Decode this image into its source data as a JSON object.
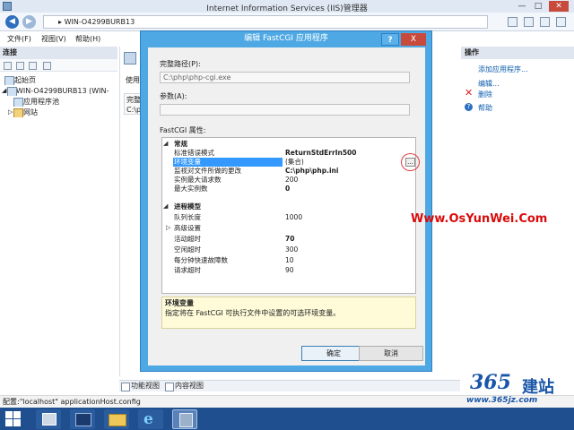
{
  "window": {
    "title": "Internet Information Services (IIS)管理器",
    "address": "WIN-O4299BURB13",
    "menu": [
      "文件(F)",
      "视图(V)",
      "帮助(H)"
    ]
  },
  "connections": {
    "heading": "连接",
    "tree": [
      "起始页",
      "WIN-O4299BURB13 (WIN-",
      "应用程序池",
      "网站"
    ]
  },
  "center": {
    "title_partial": "完",
    "label_partial": "使用",
    "col_partial": "完整",
    "cell_partial": "C:\\ph"
  },
  "actions": {
    "heading": "操作",
    "items": [
      "添加应用程序...",
      "编辑...",
      "删除",
      "帮助"
    ]
  },
  "bottom_tabs": [
    "功能视图",
    "内容视图"
  ],
  "status": "配置:\"localhost\" applicationHost.config",
  "dialog": {
    "title": "编辑 FastCGI 应用程序",
    "help_btn": "?",
    "close_btn": "X",
    "fullpath_label": "完整路径(P):",
    "fullpath_value": "C:\\php\\php-cgi.exe",
    "args_label": "参数(A):",
    "args_value": "",
    "props_label": "FastCGI 属性:",
    "sections": [
      {
        "name": "常规",
        "rows": [
          {
            "name": "标准错误模式",
            "value": "ReturnStdErrIn500",
            "bold": true
          },
          {
            "name": "环境变量",
            "value": "(集合)",
            "bold": false,
            "selected": true
          },
          {
            "name": "监视对文件所做的更改",
            "value": "C:\\php\\php.ini",
            "bold": true
          },
          {
            "name": "实例最大请求数",
            "value": "200",
            "bold": false
          },
          {
            "name": "最大实例数",
            "value": "0",
            "bold": true
          }
        ]
      },
      {
        "name": "进程模型",
        "rows": [
          {
            "name": "队列长度",
            "value": "1000",
            "bold": false
          },
          {
            "name": "高级设置",
            "value": "",
            "bold": false,
            "expandable": true
          },
          {
            "name": "活动超时",
            "value": "70",
            "bold": true
          },
          {
            "name": "空闲超时",
            "value": "300",
            "bold": false
          },
          {
            "name": "每分钟快速故障数",
            "value": "10",
            "bold": false
          },
          {
            "name": "请求超时",
            "value": "90",
            "bold": false
          }
        ]
      }
    ],
    "ellipsis": "...",
    "desc_title": "环境变量",
    "desc_text": "指定将在 FastCGI 可执行文件中设置的可选环境变量。",
    "ok": "确定",
    "cancel": "取消"
  },
  "watermark": "Www.OsYunWei.Com",
  "logo": {
    "digits": "365",
    "cn": "建站",
    "url": "www.365jz.com"
  },
  "colors": {
    "dialog_frame": "#4ea8e4",
    "selection": "#3399ff",
    "watermark": "#d80c0c",
    "taskbar": "#1f4f8f"
  }
}
